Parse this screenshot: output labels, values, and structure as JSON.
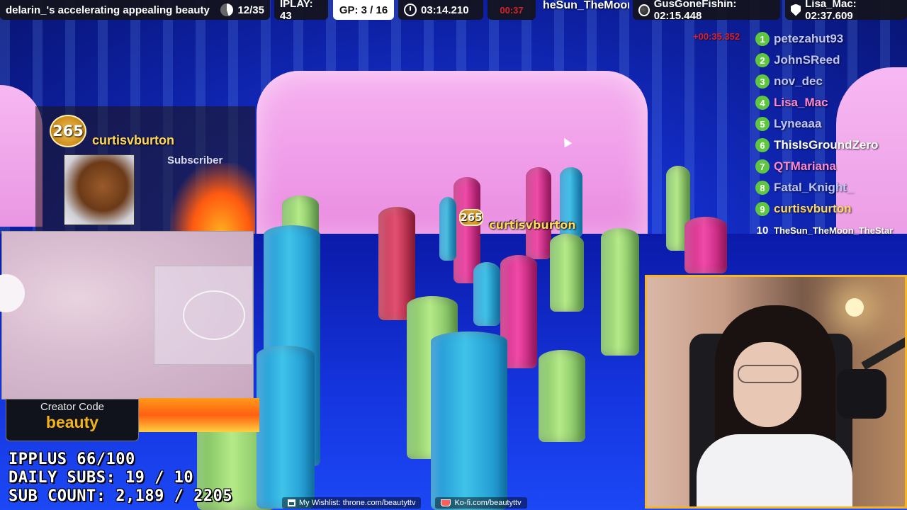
{
  "hud": {
    "title": "delarin_'s accelerating appealing beauty",
    "progress": "12/35",
    "iplay": "IPLAY: 43",
    "gp": "GP: 3 / 16",
    "timer": "03:14.210",
    "delta": "00:37",
    "leader": "heSun_TheMoon",
    "record1": "GusGoneFishin: 02:15.448",
    "record2": "Lisa_Mac: 02:37.609"
  },
  "leaderboard": {
    "split": "+00:35.352",
    "entries": [
      {
        "rank": "1",
        "name": "petezahut93",
        "color": "#bfc6ff"
      },
      {
        "rank": "2",
        "name": "JohnSReed",
        "color": "#bfc6ff"
      },
      {
        "rank": "3",
        "name": "nov_dec",
        "color": "#bfc6ff"
      },
      {
        "rank": "4",
        "name": "Lisa_Mac",
        "color": "#ff8ad0"
      },
      {
        "rank": "5",
        "name": "Lyneaaa",
        "color": "#bfc6ff"
      },
      {
        "rank": "6",
        "name": "ThisIsGroundZero",
        "color": "#ffffff"
      },
      {
        "rank": "7",
        "name": "QTMariana",
        "color": "#ff8ad0"
      },
      {
        "rank": "8",
        "name": "Fatal_Knight_",
        "color": "#bfc6ff"
      },
      {
        "rank": "9",
        "name": "curtisvburton",
        "color": "#ffd75a"
      },
      {
        "rank": "10",
        "name": "TheSun_TheMoon_TheStar",
        "color": "#ffffff"
      }
    ]
  },
  "player": {
    "level": "265",
    "name": "curtisvburton"
  },
  "alert": {
    "level": "265",
    "name": "curtisvburton",
    "subtitle": "Subscriber"
  },
  "creator": {
    "label": "Creator Code",
    "code": "beauty"
  },
  "stats": {
    "ipplus": "IPPLUS 66/100",
    "daily_subs": "DAILY SUBS: 19 / 10",
    "sub_count": "SUB COUNT: 2,189 / 2205"
  },
  "footer": {
    "wishlist": "My Wishlist: throne.com/beautyttv",
    "kofi": "Ko-fi.com/beautyttv"
  },
  "icons": [
    "pie-icon",
    "clock-icon",
    "globe-icon",
    "shield-icon",
    "gift-icon",
    "cup-icon"
  ]
}
